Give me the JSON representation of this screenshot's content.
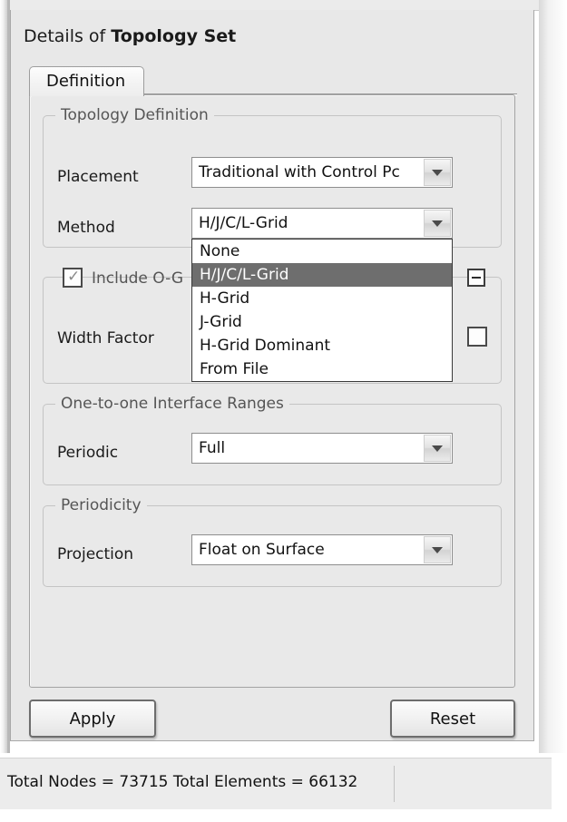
{
  "panel": {
    "title_prefix": "Details of ",
    "title_bold": "Topology Set"
  },
  "tabs": [
    {
      "label": "Definition",
      "active": true
    }
  ],
  "groups": {
    "topology_definition": {
      "legend": "Topology Definition",
      "fields": [
        {
          "label": "Placement",
          "type": "combobox",
          "value": "Traditional with Control Pc",
          "icon": "chevron-down-icon"
        },
        {
          "label": "Method",
          "type": "combobox",
          "value": "H/J/C/L-Grid",
          "icon": "chevron-down-icon",
          "expanded": true,
          "options": [
            {
              "label": "None",
              "selected": false
            },
            {
              "label": "H/J/C/L-Grid",
              "selected": true
            },
            {
              "label": "H-Grid",
              "selected": false
            },
            {
              "label": "J-Grid",
              "selected": false
            },
            {
              "label": "H-Grid Dominant",
              "selected": false
            },
            {
              "label": "From File",
              "selected": false
            }
          ]
        }
      ]
    },
    "ogrid": {
      "checkbox_label": "Include O-G",
      "checkbox_checked": true,
      "collapse_icon": "minus-box-icon",
      "fields": [
        {
          "label": "Width Factor",
          "type": "checkbox",
          "checked": false
        }
      ]
    },
    "interface_ranges": {
      "legend": "One-to-one Interface Ranges",
      "fields": [
        {
          "label": "Periodic",
          "type": "combobox",
          "value": "Full",
          "icon": "chevron-down-icon"
        }
      ]
    },
    "periodicity": {
      "legend": "Periodicity",
      "fields": [
        {
          "label": "Projection",
          "type": "combobox",
          "value": "Float on Surface",
          "icon": "chevron-down-icon"
        }
      ]
    }
  },
  "actions": {
    "apply_label": "Apply",
    "reset_label": "Reset"
  },
  "statusbar": {
    "text": "Total Nodes = 73715  Total Elements = 66132"
  },
  "colors": {
    "panel_bg": "#e8e8e8",
    "highlight": "#6e6e6e",
    "field_bg": "#ffffff",
    "group_border": "#c4c4c4"
  }
}
